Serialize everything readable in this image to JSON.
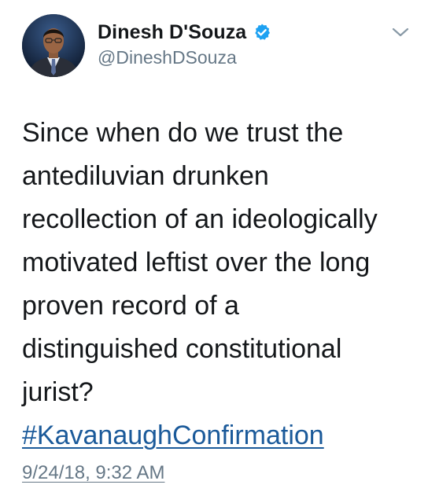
{
  "tweet": {
    "author": {
      "display_name": "Dinesh D'Souza",
      "handle": "@DineshDSouza",
      "verified_icon": "verified-badge-icon",
      "verified_color": "#1da1f2"
    },
    "menu_icon": "chevron-down-icon",
    "text_lines": [
      "Since when do we trust the",
      "antediluvian drunken",
      "recollection of an ideologically",
      "motivated leftist over the long",
      "proven record of a",
      "distinguished constitutional",
      "jurist?"
    ],
    "hashtag": "#KavanaughConfirmation",
    "hashtag_color": "#1b5a9a",
    "timestamp": "9/24/18, 9:32 AM"
  }
}
